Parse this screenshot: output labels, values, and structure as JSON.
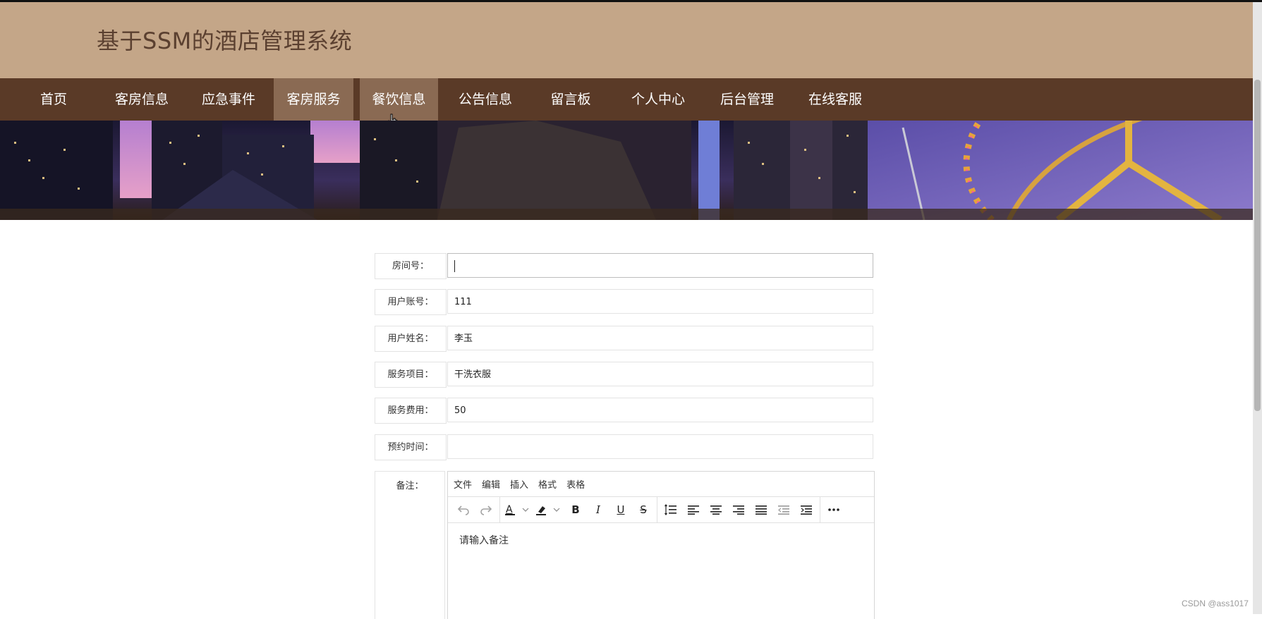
{
  "site": {
    "title": "基于SSM的酒店管理系统"
  },
  "nav": {
    "items": [
      {
        "label": "首页"
      },
      {
        "label": "客房信息"
      },
      {
        "label": "应急事件"
      },
      {
        "label": "客房服务"
      },
      {
        "label": "餐饮信息"
      },
      {
        "label": "公告信息"
      },
      {
        "label": "留言板"
      },
      {
        "label": "个人中心"
      },
      {
        "label": "后台管理"
      },
      {
        "label": "在线客服"
      }
    ],
    "active": "客房服务",
    "hover": "餐饮信息"
  },
  "form": {
    "fields": [
      {
        "label": "房间号：",
        "value": ""
      },
      {
        "label": "用户账号：",
        "value": "111"
      },
      {
        "label": "用户姓名：",
        "value": "李玉"
      },
      {
        "label": "服务项目：",
        "value": "干洗衣服"
      },
      {
        "label": "服务费用：",
        "value": "50"
      },
      {
        "label": "预约时间：",
        "value": ""
      }
    ],
    "notes": {
      "label": "备注：",
      "placeholder": "请输入备注",
      "menu": [
        "文件",
        "编辑",
        "插入",
        "格式",
        "表格"
      ],
      "toolbar_icons": [
        "undo-icon",
        "redo-icon",
        "text-color-icon",
        "highlight-color-icon",
        "bold-icon",
        "italic-icon",
        "underline-icon",
        "strikethrough-icon",
        "line-height-icon",
        "align-left-icon",
        "align-center-icon",
        "align-right-icon",
        "align-justify-icon",
        "outdent-icon",
        "indent-icon",
        "more-icon"
      ]
    }
  },
  "watermark": "CSDN @ass1017",
  "colors": {
    "header_bg": "#c4a688",
    "nav_bg": "#5a3a27",
    "nav_highlight": "#8a6a53",
    "title_color": "#5b4030"
  }
}
